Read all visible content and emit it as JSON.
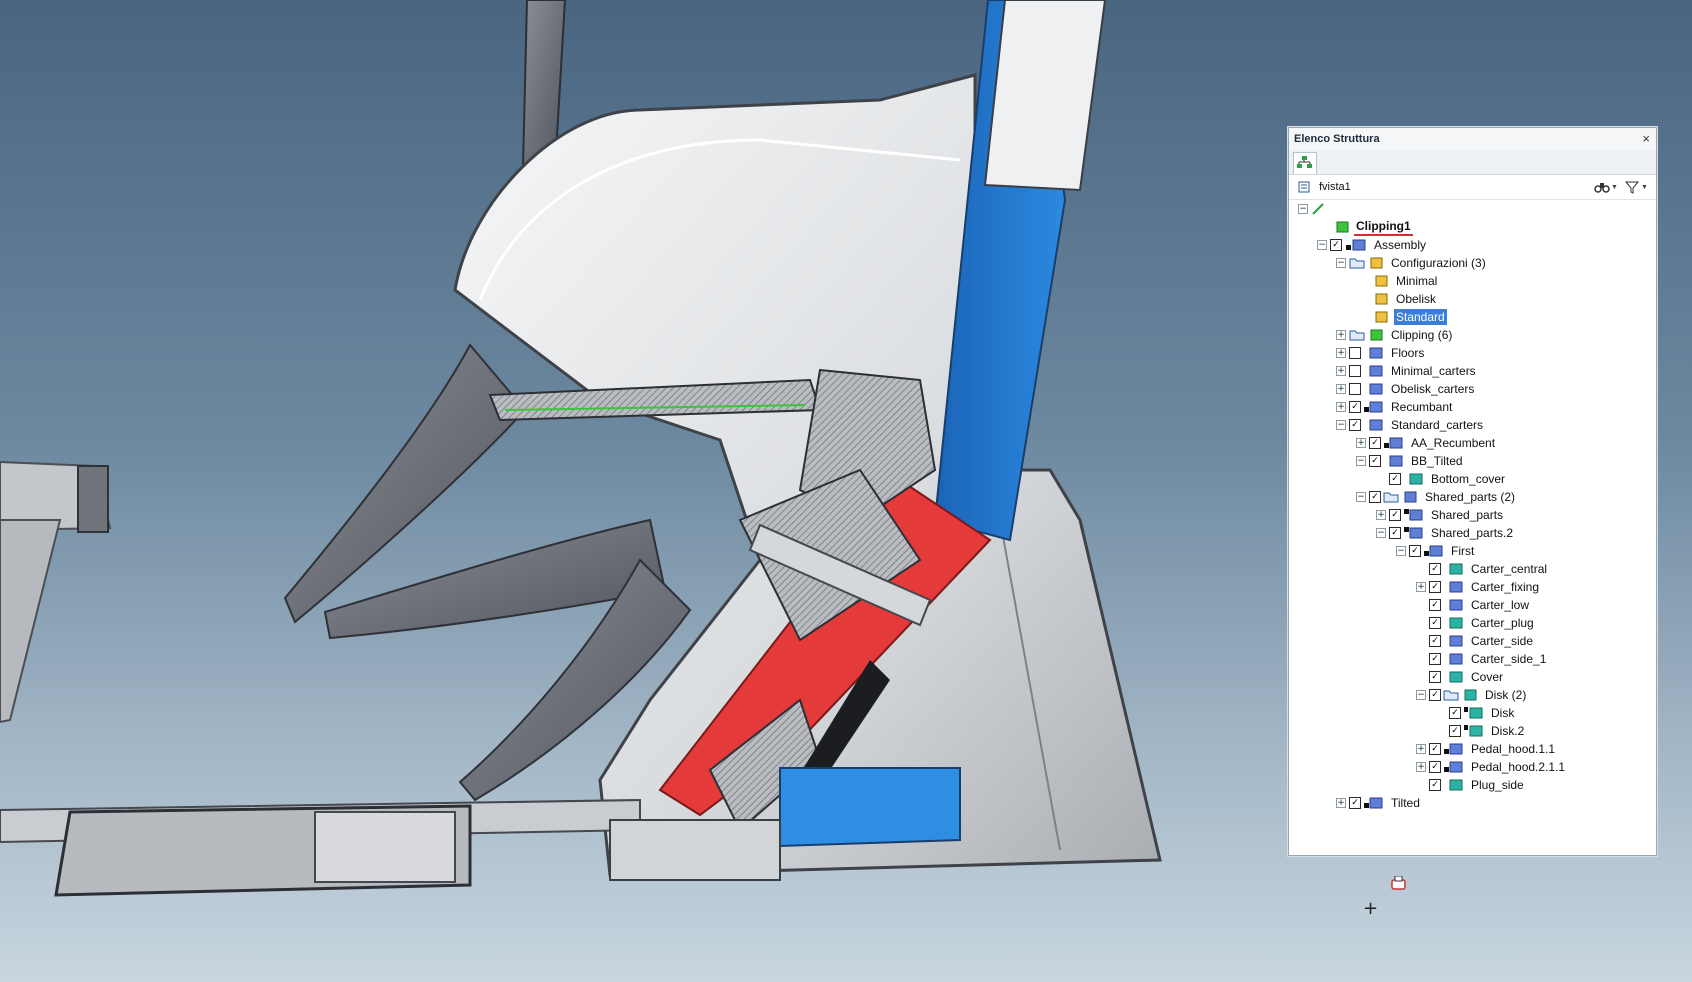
{
  "panel": {
    "title": "Elenco Struttura",
    "close_label": "×",
    "view_name": "fvista1"
  },
  "tree": [
    {
      "label": "Clipping1",
      "bold": true,
      "icon": "clipping-icon"
    },
    {
      "label": "Assembly",
      "icon": "assembly-icon"
    },
    {
      "label": "Configurazioni (3)",
      "icon": "configurations-icon"
    },
    {
      "label": "Minimal",
      "icon": "configuration-icon"
    },
    {
      "label": "Obelisk",
      "icon": "configuration-icon"
    },
    {
      "label": "Standard",
      "selected": true,
      "icon": "configuration-icon"
    },
    {
      "label": "Clipping (6)",
      "icon": "clipping-folder-icon"
    },
    {
      "label": "Floors",
      "icon": "assembly-icon"
    },
    {
      "label": "Minimal_carters",
      "icon": "assembly-icon"
    },
    {
      "label": "Obelisk_carters",
      "icon": "assembly-icon"
    },
    {
      "label": "Recumbant",
      "icon": "assembly-icon"
    },
    {
      "label": "Standard_carters",
      "icon": "assembly-icon"
    },
    {
      "label": "AA_Recumbent",
      "icon": "assembly-icon"
    },
    {
      "label": "BB_Tilted",
      "icon": "assembly-icon"
    },
    {
      "label": "Bottom_cover",
      "icon": "part-icon"
    },
    {
      "label": "Shared_parts (2)",
      "icon": "assembly-folder-icon"
    },
    {
      "label": "Shared_parts",
      "icon": "assembly-icon"
    },
    {
      "label": "Shared_parts.2",
      "icon": "assembly-icon"
    },
    {
      "label": "First",
      "icon": "assembly-icon"
    },
    {
      "label": "Carter_central",
      "icon": "part-icon"
    },
    {
      "label": "Carter_fixing",
      "icon": "assembly-icon"
    },
    {
      "label": "Carter_low",
      "icon": "assembly-icon"
    },
    {
      "label": "Carter_plug",
      "icon": "part-icon"
    },
    {
      "label": "Carter_side",
      "icon": "assembly-icon"
    },
    {
      "label": "Carter_side_1",
      "icon": "assembly-icon"
    },
    {
      "label": "Cover",
      "icon": "part-icon"
    },
    {
      "label": "Disk (2)",
      "icon": "part-folder-icon"
    },
    {
      "label": "Disk",
      "icon": "part-icon"
    },
    {
      "label": "Disk.2",
      "icon": "part-icon"
    },
    {
      "label": "Pedal_hood.1.1",
      "icon": "assembly-icon"
    },
    {
      "label": "Pedal_hood.2.1.1",
      "icon": "assembly-icon"
    },
    {
      "label": "Plug_side",
      "icon": "part-icon"
    },
    {
      "label": "Tilted",
      "icon": "assembly-icon"
    }
  ],
  "colors": {
    "selection": "#3a7fd9",
    "section_red": "#e43a3a",
    "blue_panel": "#1f78d1",
    "part_teal": "#2bb3a6"
  }
}
